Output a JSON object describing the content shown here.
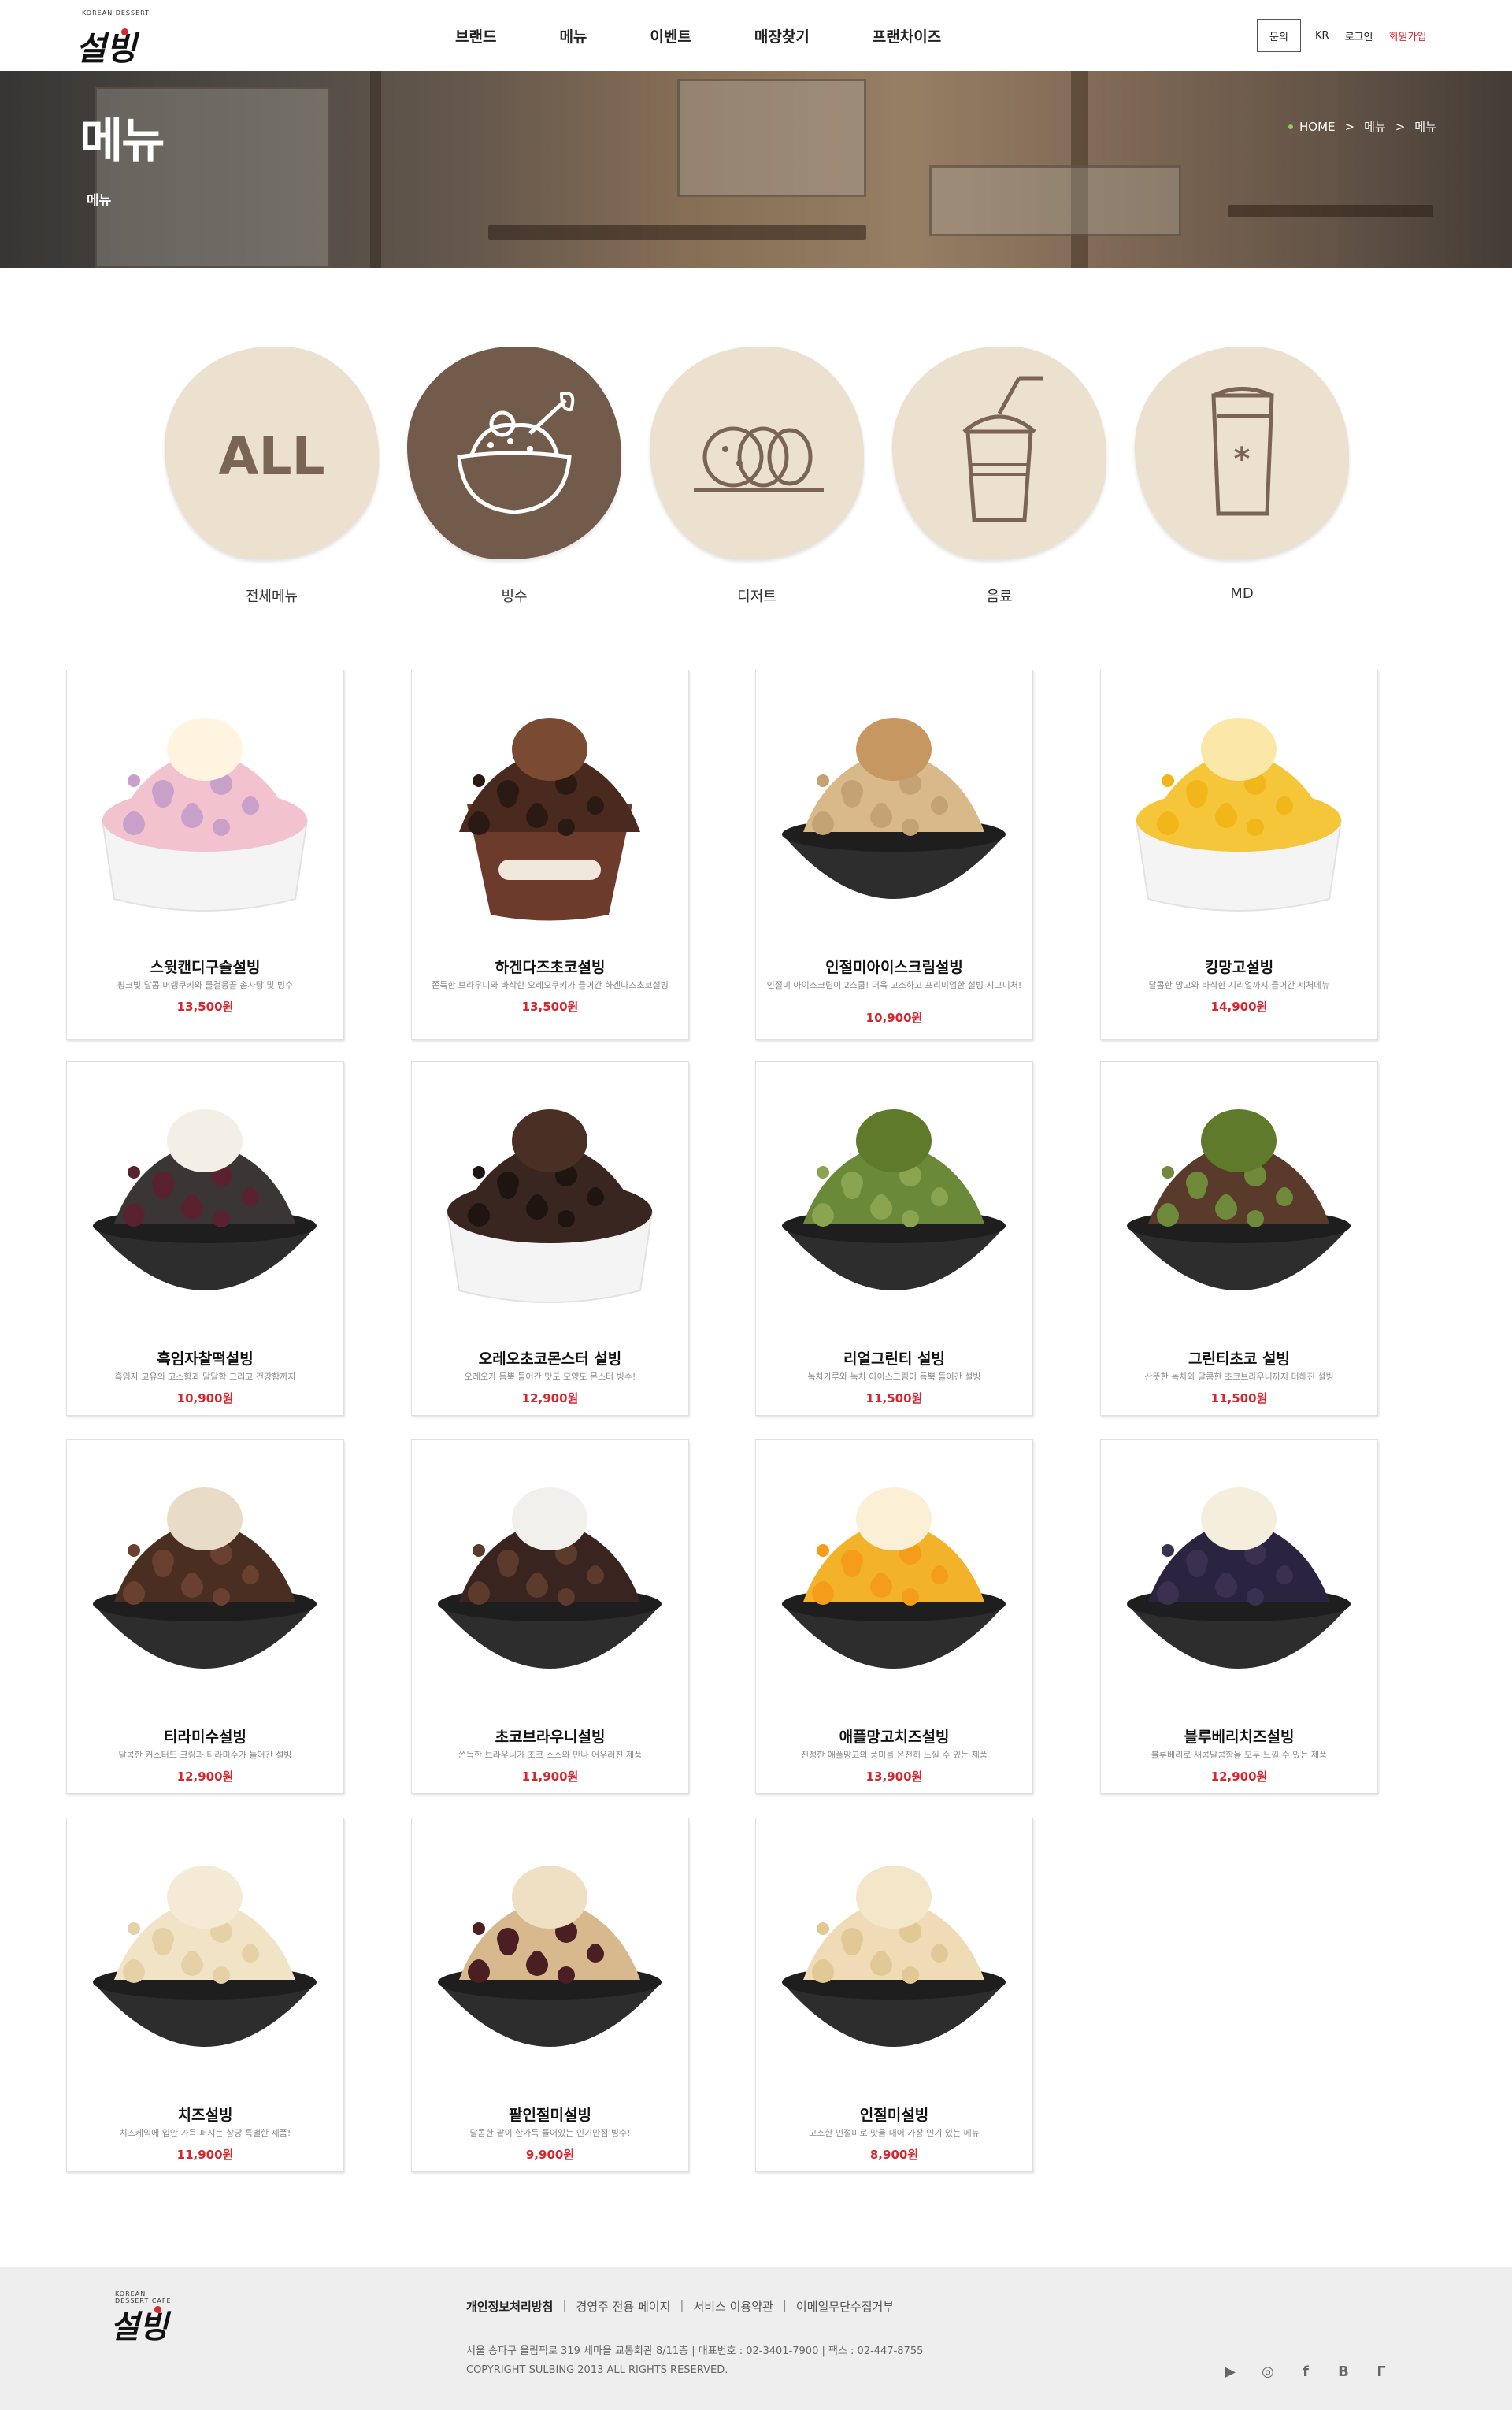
{
  "header": {
    "logo_small": "KOREAN DESSERT",
    "logo_text": "설빙",
    "nav": [
      "브랜드",
      "메뉴",
      "이벤트",
      "매장찾기",
      "프랜차이즈"
    ],
    "inquiry": "문의",
    "lang": "KR",
    "login": "로그인",
    "join": "회원가입"
  },
  "hero": {
    "title": "메뉴",
    "subtitle": "메뉴",
    "breadcrumb": [
      "HOME",
      ">",
      "메뉴",
      ">",
      "메뉴"
    ]
  },
  "categories": [
    {
      "label": "전체메뉴",
      "icon": "all-icon",
      "text": "ALL",
      "active": false
    },
    {
      "label": "빙수",
      "icon": "bingsu-bowl-icon",
      "active": true
    },
    {
      "label": "디저트",
      "icon": "rice-cake-icon",
      "active": false
    },
    {
      "label": "음료",
      "icon": "drink-cup-icon",
      "active": false
    },
    {
      "label": "MD",
      "icon": "md-tumbler-icon",
      "active": false
    }
  ],
  "products": [
    {
      "name": "스윗캔디구슬설빙",
      "desc": "핑크빛 달콤 머랭쿠키와 물결웅골 솜사탕 및 빙수",
      "price": "13,500원",
      "img": "candy-bingsu-image"
    },
    {
      "name": "하겐다즈초코설빙",
      "desc": "쫀득한 브라우니와 바삭한 오레오쿠키가 들어간 하겐다즈초코설빙",
      "price": "13,500원",
      "img": "haagendazs-choco-bingsu-image"
    },
    {
      "name": "인절미아이스크림설빙",
      "desc": "인절미 아이스크림이 2스쿱! 더욱 고소하고 프리미엄한 설빙 시그니처!",
      "price": "10,900원",
      "img": "injeolmi-icecream-bingsu-image"
    },
    {
      "name": "킹망고설빙",
      "desc": "달콤한 망고와 바삭한 시리얼까지 들어간 제처메뉴",
      "price": "14,900원",
      "img": "king-mango-bingsu-image"
    },
    {
      "name": "흑임자찰떡설빙",
      "desc": "흑임자 고유의 고소함과 달달함 그리고 건강함까지",
      "price": "10,900원",
      "img": "black-sesame-bingsu-image"
    },
    {
      "name": "오레오초코몬스터 설빙",
      "desc": "오레오가 듬뿍 들어간 맛도 모양도 몬스터 빙수!",
      "price": "12,900원",
      "img": "oreo-choco-monster-bingsu-image"
    },
    {
      "name": "리얼그린티 설빙",
      "desc": "녹차가루와 녹차 아이스크림이 듬뿍 들어간 설빙",
      "price": "11,500원",
      "img": "real-greentea-bingsu-image"
    },
    {
      "name": "그린티초코 설빙",
      "desc": "산뜻한 녹차와 달콤한 초코브라우니까지 더해진 설빙",
      "price": "11,500원",
      "img": "greentea-choco-bingsu-image"
    },
    {
      "name": "티라미수설빙",
      "desc": "달콤한 커스터드 크림과 티라미수가 들어간 설빙",
      "price": "12,900원",
      "img": "tiramisu-bingsu-image"
    },
    {
      "name": "초코브라우니설빙",
      "desc": "쫀득한 브라우니가 초코 소스와 만나 어우러진 제품",
      "price": "11,900원",
      "img": "choco-brownie-bingsu-image"
    },
    {
      "name": "애플망고치즈설빙",
      "desc": "진정한 애플망고의 풍미를 온전히 느낄 수 있는 제품",
      "price": "13,900원",
      "img": "applemango-cheese-bingsu-image"
    },
    {
      "name": "블루베리치즈설빙",
      "desc": "블루베리로 새콤달콤함을 모두 느낄 수 있는 제품",
      "price": "12,900원",
      "img": "blueberry-cheese-bingsu-image"
    },
    {
      "name": "치즈설빙",
      "desc": "치즈케익에 입안 가득 퍼지는 상당 특별한 제품!",
      "price": "11,900원",
      "img": "cheese-bingsu-image"
    },
    {
      "name": "팥인절미설빙",
      "desc": "달콤한 팥이 한가득 들어있는 인기만점 빙수!",
      "price": "9,900원",
      "img": "redbean-injeolmi-bingsu-image"
    },
    {
      "name": "인절미설빙",
      "desc": "고소한 인절미로 맛을 내어 가장 인기 있는 메뉴",
      "price": "8,900원",
      "img": "injeolmi-bingsu-image"
    }
  ],
  "footer": {
    "logo_small": "KOREAN DESSERT CAFE",
    "logo_text": "설빙",
    "links": [
      "개인정보처리방침",
      "경영주 전용 페이지",
      "서비스 이용약관",
      "이메일무단수집거부"
    ],
    "address": "서울 송파구 올림픽로 319 세마을 교통회관 8/11층  |  대표번호 : 02-3401-7900  |  팩스 : 02-447-8755",
    "copyright": "COPYRIGHT SULBING 2013 ALL RIGHTS RESERVED.",
    "sns": [
      {
        "icon": "youtube-icon",
        "glyph": "▶"
      },
      {
        "icon": "instagram-icon",
        "glyph": "◎"
      },
      {
        "icon": "facebook-icon",
        "glyph": "f"
      },
      {
        "icon": "blog-icon",
        "glyph": "B"
      },
      {
        "icon": "kakao-story-icon",
        "glyph": "ᒥ"
      }
    ]
  },
  "colors": {
    "accent_red": "#d6262e",
    "category_light": "#ece0cf",
    "category_dark": "#725b4b",
    "footer_bg": "#eeeeef"
  }
}
